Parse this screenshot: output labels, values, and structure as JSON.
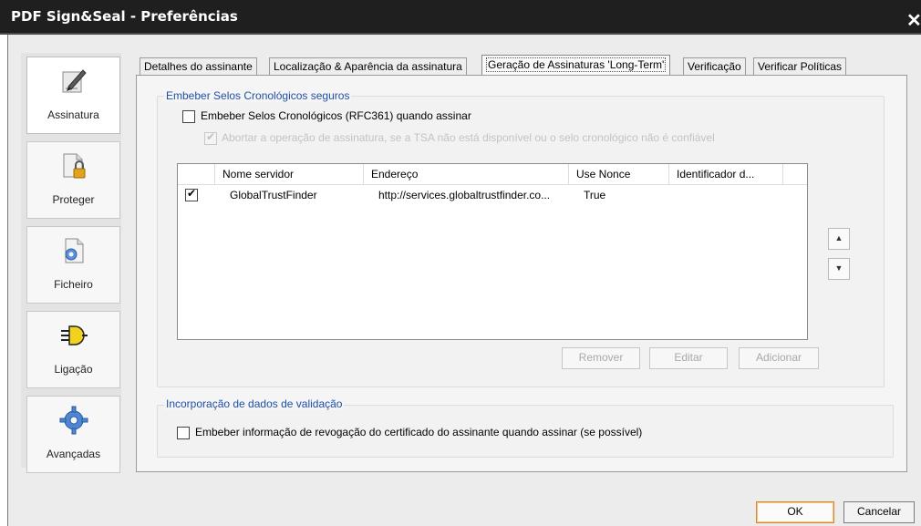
{
  "window": {
    "title": "PDF Sign&Seal - Preferências",
    "close_glyph": "✕"
  },
  "sidebar": {
    "items": [
      {
        "label": "Assinatura",
        "icon": "pen-signature-icon",
        "active": true
      },
      {
        "label": "Proteger",
        "icon": "document-lock-icon",
        "active": false
      },
      {
        "label": "Ficheiro",
        "icon": "file-gear-icon",
        "active": false
      },
      {
        "label": "Ligação",
        "icon": "plug-icon",
        "active": false
      },
      {
        "label": "Avançadas",
        "icon": "gear-icon",
        "active": false
      }
    ]
  },
  "tabs": [
    {
      "label": "Detalhes do assinante",
      "active": false
    },
    {
      "label": "Localização & Aparência da assinatura",
      "active": false
    },
    {
      "label": "Geração de Assinaturas 'Long-Term'",
      "active": true
    },
    {
      "label": "Verificação",
      "active": false
    },
    {
      "label": "Verificar Políticas",
      "active": false
    }
  ],
  "timestamps": {
    "title": "Embeber Selos Cronológicos seguros",
    "embed_checkbox": {
      "label": "Embeber Selos Cronológicos (RFC361) quando assinar",
      "checked": false
    },
    "abort_checkbox": {
      "label": "Abortar a operação de assinatura, se a TSA não está disponível ou o selo cronológico não é confiável",
      "checked": true,
      "disabled": true
    },
    "columns": [
      "Nome servidor",
      "Endereço",
      "Use Nonce",
      "Identificador d..."
    ],
    "rows": [
      {
        "checked": true,
        "name": "GlobalTrustFinder",
        "address": "http://services.globaltrustfinder.co...",
        "nonce": "True",
        "identifier": ""
      }
    ],
    "move_up_glyph": "▲",
    "move_down_glyph": "▼",
    "buttons": {
      "remove": "Remover",
      "edit": "Editar",
      "add": "Adicionar"
    }
  },
  "validation": {
    "title": "Incorporação de dados de validação",
    "revocation_checkbox": {
      "label": "Embeber informação de revogação do certificado do assinante quando assinar (se possível)",
      "checked": false
    }
  },
  "footer": {
    "ok": "OK",
    "cancel": "Cancelar"
  },
  "glyphs": {
    "check": "✔"
  },
  "colors": {
    "group_title": "#1f4fa8",
    "titlebar": "#1f1f1f",
    "ok_border": "#d6892a"
  }
}
